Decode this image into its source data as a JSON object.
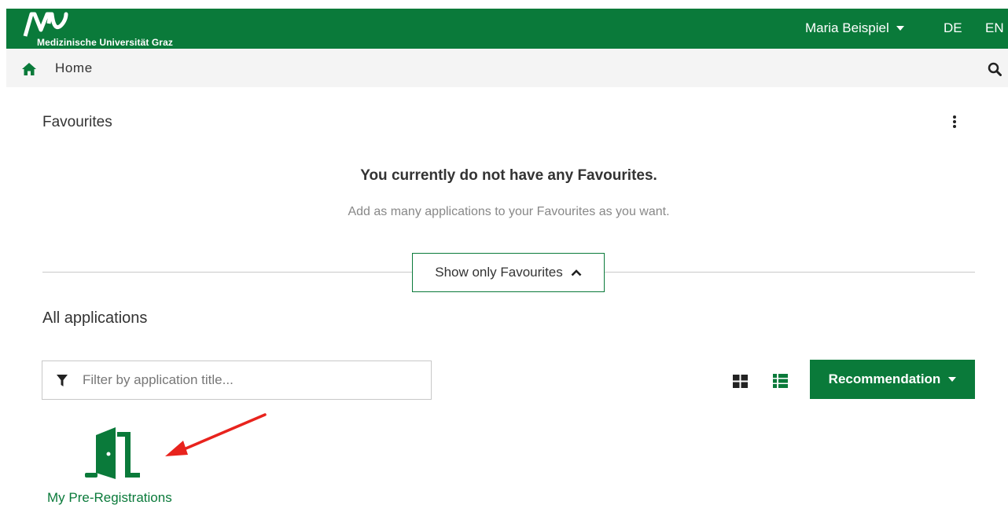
{
  "brand": {
    "logo_text": "Medizinische Universität Graz",
    "primary_color": "#0a7a3a"
  },
  "header": {
    "user_name": "Maria Beispiel",
    "lang_de": "DE",
    "lang_en": "EN"
  },
  "breadcrumb": {
    "home_label": "Home",
    "icons": [
      "home-icon",
      "search-icon"
    ]
  },
  "favourites": {
    "title": "Favourites",
    "empty_title": "You currently do not have any Favourites.",
    "empty_subtitle": "Add as many applications to your Favourites as you want.",
    "toggle_label": "Show only Favourites"
  },
  "applications": {
    "title": "All applications",
    "filter_placeholder": "Filter by application title...",
    "filter_value": "",
    "sort_button_label": "Recommendation",
    "items": [
      {
        "label": "My Pre-Registrations",
        "icon": "door-open-icon"
      }
    ]
  },
  "annotation": {
    "arrow_color": "#e8231d"
  }
}
